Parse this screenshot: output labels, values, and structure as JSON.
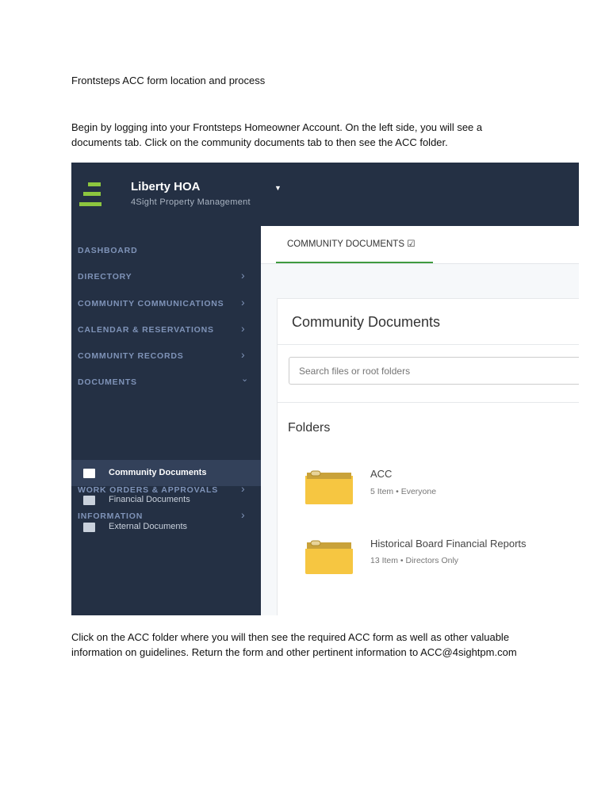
{
  "doc": {
    "heading": "Frontsteps ACC form location and process",
    "para1_line1": "Begin by logging into your Frontsteps Homeowner Account.  On the left side, you will see a",
    "para1_line2": "documents tab.  Click on the community documents tab to then see the ACC folder.",
    "para2_line1": "Click on the ACC folder where you will then see the required ACC form as well as other valuable",
    "para2_line2": "information on guidelines.  Return the form and other pertinent information to ACC@4sightpm.com"
  },
  "app": {
    "title": "Liberty HOA",
    "subtitle": "4Sight Property Management",
    "accent": "#8dc63f"
  },
  "sidebar": {
    "items": [
      {
        "label": "DASHBOARD"
      },
      {
        "label": "DIRECTORY"
      },
      {
        "label": "COMMUNITY COMMUNICATIONS"
      },
      {
        "label": "CALENDAR & RESERVATIONS"
      },
      {
        "label": "COMMUNITY RECORDS"
      },
      {
        "label": "DOCUMENTS"
      },
      {
        "label": "WORK ORDERS & APPROVALS"
      },
      {
        "label": "INFORMATION"
      }
    ],
    "sub_items": [
      {
        "label": "Community Documents"
      },
      {
        "label": "Financial Documents"
      },
      {
        "label": "External Documents"
      }
    ]
  },
  "main": {
    "tab": "COMMUNITY DOCUMENTS",
    "title": "Community Documents",
    "search_placeholder": "Search files or root folders",
    "folders_heading": "Folders",
    "folders": [
      {
        "name": "ACC",
        "meta": "5 Item • Everyone"
      },
      {
        "name": "Historical Board Financial Reports",
        "meta": "13 Item • Directors Only"
      }
    ]
  }
}
